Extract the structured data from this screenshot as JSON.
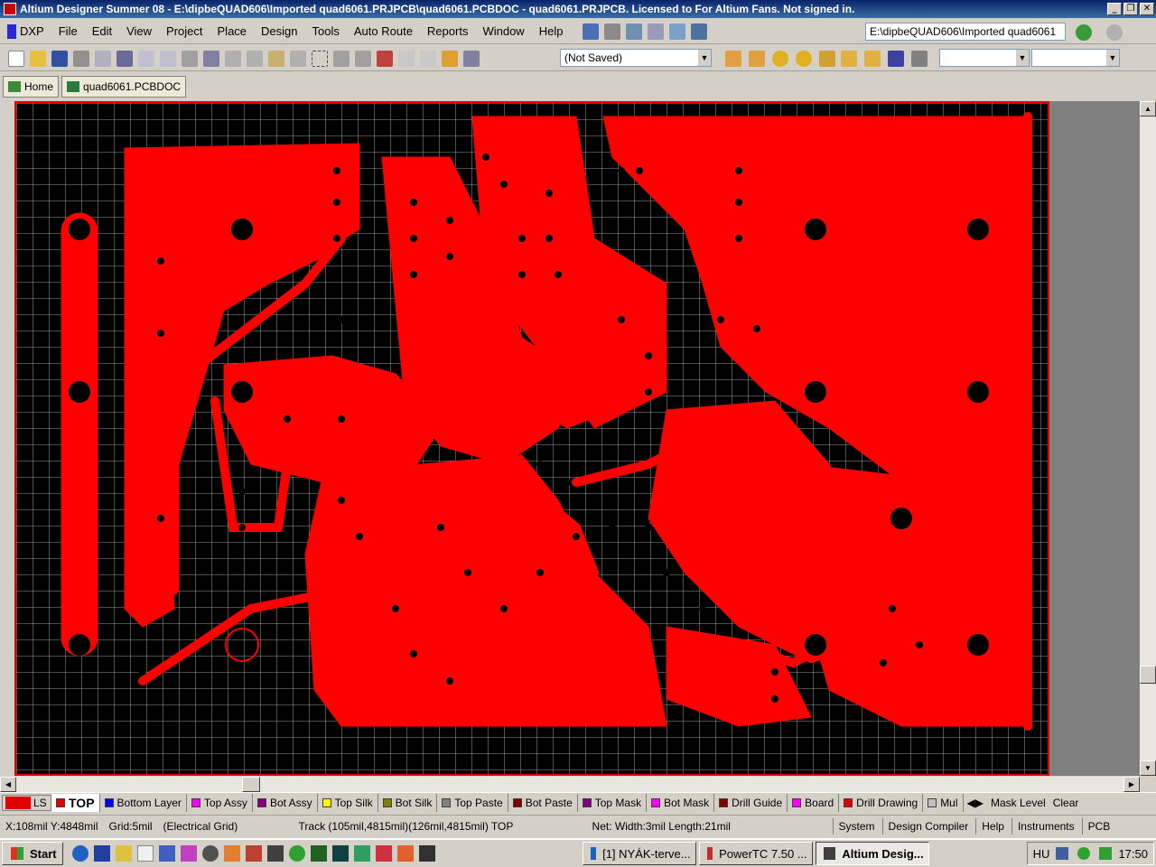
{
  "window": {
    "title": "Altium Designer Summer 08 - E:\\dipbeQUAD606\\Imported quad6061.PRJPCB\\quad6061.PCBDOC - quad6061.PRJPCB. Licensed to For Altium Fans. Not signed in."
  },
  "menu": {
    "items": [
      "DXP",
      "File",
      "Edit",
      "View",
      "Project",
      "Place",
      "Design",
      "Tools",
      "Auto Route",
      "Reports",
      "Window",
      "Help"
    ]
  },
  "path_box": {
    "value": "E:\\dipbeQUAD606\\Imported quad6061"
  },
  "toolbar": {
    "save_status": "(Not Saved)"
  },
  "tabs": [
    {
      "label": "Home"
    },
    {
      "label": "quad6061.PCBDOC"
    }
  ],
  "layers": {
    "ls_label": "LS",
    "items": [
      {
        "label": "TOP",
        "color": "#e00000"
      },
      {
        "label": "Bottom Layer",
        "color": "#0000ff"
      },
      {
        "label": "Top Assy",
        "color": "#ff00ff"
      },
      {
        "label": "Bot Assy",
        "color": "#800080"
      },
      {
        "label": "Top Silk",
        "color": "#ffff00"
      },
      {
        "label": "Bot Silk",
        "color": "#808000"
      },
      {
        "label": "Top Paste",
        "color": "#808080"
      },
      {
        "label": "Bot Paste",
        "color": "#800000"
      },
      {
        "label": "Top Mask",
        "color": "#800080"
      },
      {
        "label": "Bot Mask",
        "color": "#ff00ff"
      },
      {
        "label": "Drill Guide",
        "color": "#800000"
      },
      {
        "label": "Board",
        "color": "#ff00ff"
      },
      {
        "label": "Drill Drawing",
        "color": "#e00000"
      },
      {
        "label": "Mul",
        "color": "#c0c0c0"
      }
    ],
    "mask_level": "Mask Level",
    "clear": "Clear"
  },
  "status": {
    "coords": "X:108mil Y:4848mil",
    "grid": "Grid:5mil",
    "grid_type": "(Electrical Grid)",
    "track": "Track (105mil,4815mil)(126mil,4815mil)  TOP",
    "net": "Net: Width:3mil Length:21mil",
    "panels": [
      "System",
      "Design Compiler",
      "Help",
      "Instruments",
      "PCB"
    ]
  },
  "taskbar": {
    "start": "Start",
    "tasks": [
      {
        "label": "[1] NYÁK-terve...",
        "active": false
      },
      {
        "label": "PowerTC 7.50 ...",
        "active": false
      },
      {
        "label": "Altium Desig...",
        "active": true
      }
    ],
    "lang": "HU",
    "clock": "17:50"
  }
}
